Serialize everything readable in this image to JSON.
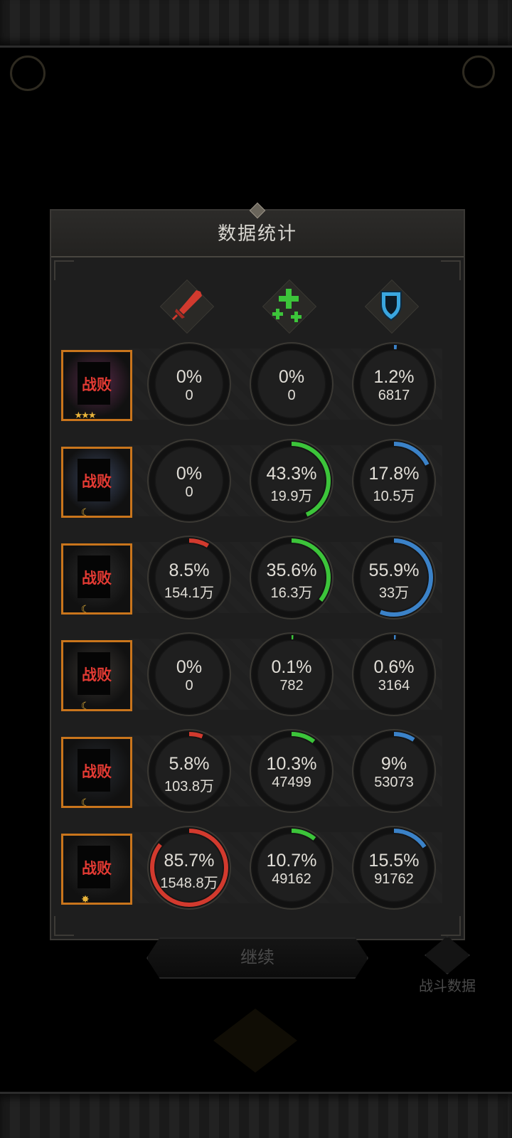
{
  "panel": {
    "title": "数据统计"
  },
  "columns": [
    {
      "icon": "sword-icon",
      "color": "#d23a2e"
    },
    {
      "icon": "heal-cross-icon",
      "color": "#3cc43a"
    },
    {
      "icon": "shield-icon",
      "color": "#3b82c8"
    }
  ],
  "rows": [
    {
      "status": "战败",
      "badge": "stars",
      "portrait_tint": "#5a2a4a",
      "stats": [
        {
          "percent": "0%",
          "amount": "0",
          "fraction": 0
        },
        {
          "percent": "0%",
          "amount": "0",
          "fraction": 0
        },
        {
          "percent": "1.2%",
          "amount": "6817",
          "fraction": 0.012
        }
      ]
    },
    {
      "status": "战败",
      "badge": "moon",
      "portrait_tint": "#3a4660",
      "stats": [
        {
          "percent": "0%",
          "amount": "0",
          "fraction": 0
        },
        {
          "percent": "43.3%",
          "amount": "19.9万",
          "fraction": 0.433
        },
        {
          "percent": "17.8%",
          "amount": "10.5万",
          "fraction": 0.178
        }
      ]
    },
    {
      "status": "战败",
      "badge": "moon",
      "portrait_tint": "#2e2e2e",
      "stats": [
        {
          "percent": "8.5%",
          "amount": "154.1万",
          "fraction": 0.085
        },
        {
          "percent": "35.6%",
          "amount": "16.3万",
          "fraction": 0.356
        },
        {
          "percent": "55.9%",
          "amount": "33万",
          "fraction": 0.559
        }
      ]
    },
    {
      "status": "战败",
      "badge": "moon",
      "portrait_tint": "#3a3632",
      "stats": [
        {
          "percent": "0%",
          "amount": "0",
          "fraction": 0
        },
        {
          "percent": "0.1%",
          "amount": "782",
          "fraction": 0.001
        },
        {
          "percent": "0.6%",
          "amount": "3164",
          "fraction": 0.006
        }
      ]
    },
    {
      "status": "战败",
      "badge": "moon",
      "portrait_tint": "#262a30",
      "stats": [
        {
          "percent": "5.8%",
          "amount": "103.8万",
          "fraction": 0.058
        },
        {
          "percent": "10.3%",
          "amount": "47499",
          "fraction": 0.103
        },
        {
          "percent": "9%",
          "amount": "53073",
          "fraction": 0.09
        }
      ]
    },
    {
      "status": "战败",
      "badge": "sun",
      "portrait_tint": "#2a2a2a",
      "stats": [
        {
          "percent": "85.7%",
          "amount": "1548.8万",
          "fraction": 0.857
        },
        {
          "percent": "10.7%",
          "amount": "49162",
          "fraction": 0.107
        },
        {
          "percent": "15.5%",
          "amount": "91762",
          "fraction": 0.155
        }
      ]
    }
  ],
  "continue_button": {
    "label": "继续"
  },
  "battle_data_button": {
    "label": "战斗数据"
  },
  "colors": {
    "ring_track": "#111111",
    "ring_border": "#3a3833",
    "portrait_border": "#c9751c",
    "defeat_text": "#e23a33"
  }
}
